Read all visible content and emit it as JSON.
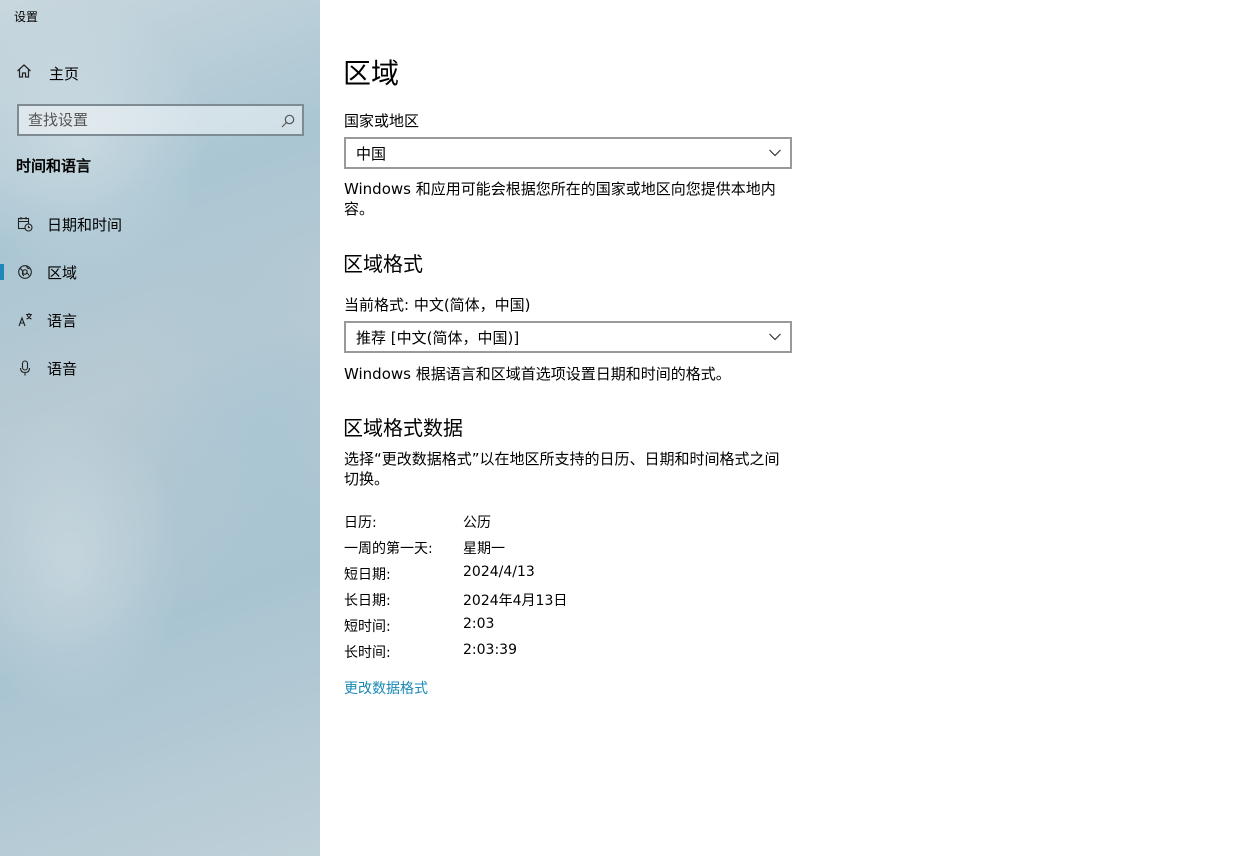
{
  "window": {
    "title": "设置"
  },
  "sidebar": {
    "home_label": "主页",
    "search": {
      "placeholder": "查找设置",
      "value": ""
    },
    "section_title": "时间和语言",
    "items": [
      {
        "label": "日期和时间",
        "icon": "calendar-clock-icon",
        "active": false
      },
      {
        "label": "区域",
        "icon": "globe-icon",
        "active": true
      },
      {
        "label": "语言",
        "icon": "language-icon",
        "active": false
      },
      {
        "label": "语音",
        "icon": "microphone-icon",
        "active": false
      }
    ],
    "accent_color": "#1f88b8"
  },
  "main": {
    "title": "区域",
    "country": {
      "label": "国家或地区",
      "selected": "中国",
      "description": "Windows 和应用可能会根据您所在的国家或地区向您提供本地内容。"
    },
    "regional_format": {
      "heading": "区域格式",
      "current_label": "当前格式: 中文(简体，中国)",
      "selected": "推荐 [中文(简体，中国)]",
      "description": "Windows 根据语言和区域首选项设置日期和时间的格式。"
    },
    "format_data": {
      "heading": "区域格式数据",
      "description": "选择“更改数据格式”以在地区所支持的日历、日期和时间格式之间切换。",
      "rows": [
        {
          "key": "日历:",
          "value": "公历"
        },
        {
          "key": "一周的第一天:",
          "value": "星期一"
        },
        {
          "key": "短日期:",
          "value": "2024/4/13"
        },
        {
          "key": "长日期:",
          "value": "2024年4月13日"
        },
        {
          "key": "短时间:",
          "value": "2:03"
        },
        {
          "key": "长时间:",
          "value": "2:03:39"
        }
      ],
      "change_link": "更改数据格式"
    },
    "link_color": "#1a88b5"
  }
}
